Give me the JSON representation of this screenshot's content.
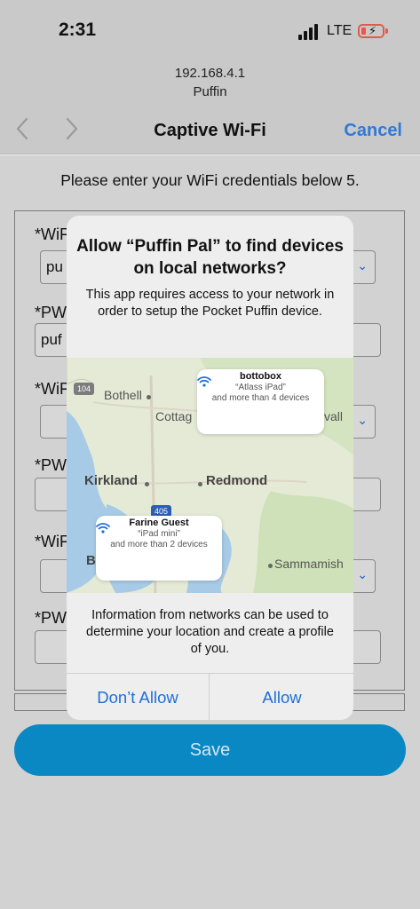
{
  "status_bar": {
    "time": "2:31",
    "network": "LTE"
  },
  "header": {
    "url": "192.168.4.1",
    "site_name": "Puffin"
  },
  "nav": {
    "back_icon": "chevron-left-icon",
    "forward_icon": "chevron-right-icon",
    "title": "Captive Wi-Fi",
    "cancel_label": "Cancel"
  },
  "form": {
    "instructions": "Please enter your WiFi credentials below 5.",
    "fields": [
      {
        "label": "*WiF",
        "value": "pu",
        "type": "select"
      },
      {
        "label": "*PW",
        "value": "puf",
        "type": "text"
      },
      {
        "label": "*WiF",
        "value": "",
        "type": "select"
      },
      {
        "label": "*PW",
        "value": "",
        "type": "text"
      },
      {
        "label": "*WiF",
        "value": "",
        "type": "select"
      },
      {
        "label": "*PW",
        "value": "",
        "type": "text"
      }
    ],
    "save_label": "Save"
  },
  "alert": {
    "title": "Allow “Puffin Pal” to find devices on local networks?",
    "message": "This app requires access to your network in order to setup the Pocket Puffin device.",
    "map": {
      "places": [
        "Bothell",
        "Cottag",
        "vall",
        "Kirkland",
        "Redmond",
        "B",
        "Sammamish"
      ],
      "shields": [
        "104",
        "405"
      ],
      "cards": [
        {
          "network": "bottobox",
          "device": "“Atlass iPad”",
          "more": "and more than 4 devices"
        },
        {
          "network": "Farine Guest",
          "device": "“iPad mini”",
          "more": "and more than 2 devices"
        }
      ]
    },
    "footer": "Information from networks can be used to determine your location and create a profile of you.",
    "deny_label": "Don’t Allow",
    "allow_label": "Allow"
  }
}
